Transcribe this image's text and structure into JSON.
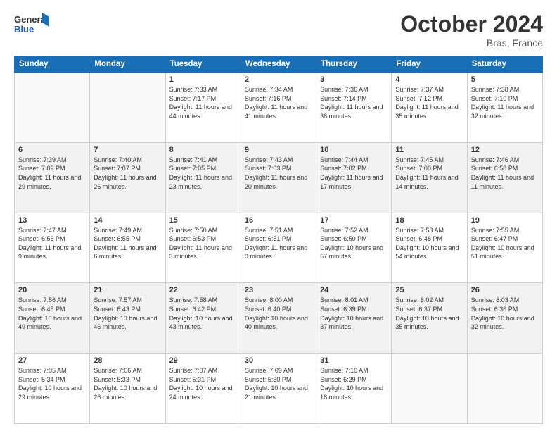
{
  "header": {
    "logo_general": "General",
    "logo_blue": "Blue",
    "month_title": "October 2024",
    "location": "Bras, France"
  },
  "weekdays": [
    "Sunday",
    "Monday",
    "Tuesday",
    "Wednesday",
    "Thursday",
    "Friday",
    "Saturday"
  ],
  "weeks": [
    [
      {
        "day": "",
        "info": ""
      },
      {
        "day": "",
        "info": ""
      },
      {
        "day": "1",
        "info": "Sunrise: 7:33 AM\nSunset: 7:17 PM\nDaylight: 11 hours and 44 minutes."
      },
      {
        "day": "2",
        "info": "Sunrise: 7:34 AM\nSunset: 7:16 PM\nDaylight: 11 hours and 41 minutes."
      },
      {
        "day": "3",
        "info": "Sunrise: 7:36 AM\nSunset: 7:14 PM\nDaylight: 11 hours and 38 minutes."
      },
      {
        "day": "4",
        "info": "Sunrise: 7:37 AM\nSunset: 7:12 PM\nDaylight: 11 hours and 35 minutes."
      },
      {
        "day": "5",
        "info": "Sunrise: 7:38 AM\nSunset: 7:10 PM\nDaylight: 11 hours and 32 minutes."
      }
    ],
    [
      {
        "day": "6",
        "info": "Sunrise: 7:39 AM\nSunset: 7:09 PM\nDaylight: 11 hours and 29 minutes."
      },
      {
        "day": "7",
        "info": "Sunrise: 7:40 AM\nSunset: 7:07 PM\nDaylight: 11 hours and 26 minutes."
      },
      {
        "day": "8",
        "info": "Sunrise: 7:41 AM\nSunset: 7:05 PM\nDaylight: 11 hours and 23 minutes."
      },
      {
        "day": "9",
        "info": "Sunrise: 7:43 AM\nSunset: 7:03 PM\nDaylight: 11 hours and 20 minutes."
      },
      {
        "day": "10",
        "info": "Sunrise: 7:44 AM\nSunset: 7:02 PM\nDaylight: 11 hours and 17 minutes."
      },
      {
        "day": "11",
        "info": "Sunrise: 7:45 AM\nSunset: 7:00 PM\nDaylight: 11 hours and 14 minutes."
      },
      {
        "day": "12",
        "info": "Sunrise: 7:46 AM\nSunset: 6:58 PM\nDaylight: 11 hours and 11 minutes."
      }
    ],
    [
      {
        "day": "13",
        "info": "Sunrise: 7:47 AM\nSunset: 6:56 PM\nDaylight: 11 hours and 9 minutes."
      },
      {
        "day": "14",
        "info": "Sunrise: 7:49 AM\nSunset: 6:55 PM\nDaylight: 11 hours and 6 minutes."
      },
      {
        "day": "15",
        "info": "Sunrise: 7:50 AM\nSunset: 6:53 PM\nDaylight: 11 hours and 3 minutes."
      },
      {
        "day": "16",
        "info": "Sunrise: 7:51 AM\nSunset: 6:51 PM\nDaylight: 11 hours and 0 minutes."
      },
      {
        "day": "17",
        "info": "Sunrise: 7:52 AM\nSunset: 6:50 PM\nDaylight: 10 hours and 57 minutes."
      },
      {
        "day": "18",
        "info": "Sunrise: 7:53 AM\nSunset: 6:48 PM\nDaylight: 10 hours and 54 minutes."
      },
      {
        "day": "19",
        "info": "Sunrise: 7:55 AM\nSunset: 6:47 PM\nDaylight: 10 hours and 51 minutes."
      }
    ],
    [
      {
        "day": "20",
        "info": "Sunrise: 7:56 AM\nSunset: 6:45 PM\nDaylight: 10 hours and 49 minutes."
      },
      {
        "day": "21",
        "info": "Sunrise: 7:57 AM\nSunset: 6:43 PM\nDaylight: 10 hours and 46 minutes."
      },
      {
        "day": "22",
        "info": "Sunrise: 7:58 AM\nSunset: 6:42 PM\nDaylight: 10 hours and 43 minutes."
      },
      {
        "day": "23",
        "info": "Sunrise: 8:00 AM\nSunset: 6:40 PM\nDaylight: 10 hours and 40 minutes."
      },
      {
        "day": "24",
        "info": "Sunrise: 8:01 AM\nSunset: 6:39 PM\nDaylight: 10 hours and 37 minutes."
      },
      {
        "day": "25",
        "info": "Sunrise: 8:02 AM\nSunset: 6:37 PM\nDaylight: 10 hours and 35 minutes."
      },
      {
        "day": "26",
        "info": "Sunrise: 8:03 AM\nSunset: 6:36 PM\nDaylight: 10 hours and 32 minutes."
      }
    ],
    [
      {
        "day": "27",
        "info": "Sunrise: 7:05 AM\nSunset: 5:34 PM\nDaylight: 10 hours and 29 minutes."
      },
      {
        "day": "28",
        "info": "Sunrise: 7:06 AM\nSunset: 5:33 PM\nDaylight: 10 hours and 26 minutes."
      },
      {
        "day": "29",
        "info": "Sunrise: 7:07 AM\nSunset: 5:31 PM\nDaylight: 10 hours and 24 minutes."
      },
      {
        "day": "30",
        "info": "Sunrise: 7:09 AM\nSunset: 5:30 PM\nDaylight: 10 hours and 21 minutes."
      },
      {
        "day": "31",
        "info": "Sunrise: 7:10 AM\nSunset: 5:29 PM\nDaylight: 10 hours and 18 minutes."
      },
      {
        "day": "",
        "info": ""
      },
      {
        "day": "",
        "info": ""
      }
    ]
  ]
}
